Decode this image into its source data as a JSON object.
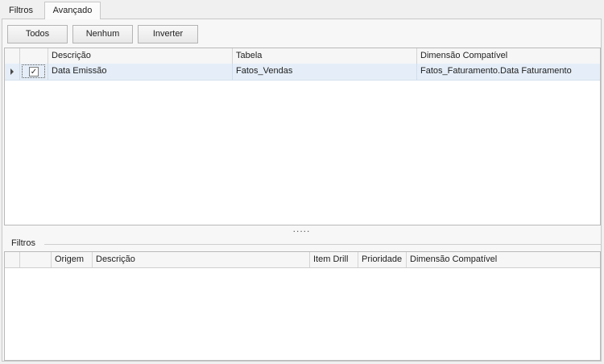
{
  "tabs": [
    {
      "label": "Filtros",
      "active": false
    },
    {
      "label": "Avançado",
      "active": true
    }
  ],
  "toolbar": {
    "all_label": "Todos",
    "none_label": "Nenhum",
    "invert_label": "Inverter"
  },
  "top_grid": {
    "columns": [
      "Descrição",
      "Tabela",
      "Dimensão Compatível"
    ],
    "rows": [
      {
        "checked": true,
        "check_glyph": "✓",
        "descricao": "Data Emissão",
        "tabela": "Fatos_Vendas",
        "dimensao": "Fatos_Faturamento.Data Faturamento"
      }
    ]
  },
  "splitter": {
    "grip": "....."
  },
  "filters_group": {
    "title": "Filtros",
    "columns": [
      "Origem",
      "Descrição",
      "Item Drill",
      "Prioridade",
      "Dimensão Compatível"
    ]
  },
  "colors": {
    "selected_row": "#e5eef8",
    "panel_bg": "#f7f7f7",
    "border": "#b9b9b9"
  }
}
